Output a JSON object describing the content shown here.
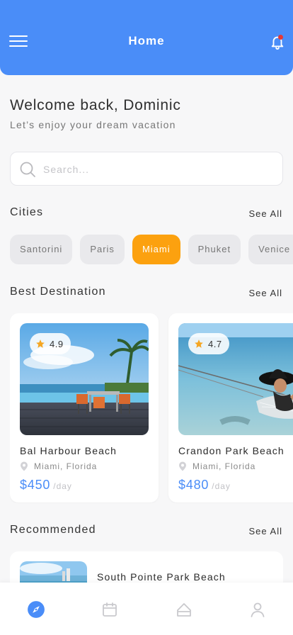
{
  "header": {
    "title": "Home",
    "menu_icon": "hamburger-menu-icon",
    "notification_icon": "bell-icon",
    "has_unread_notifications": true
  },
  "greeting": {
    "title": "Welcome back, Dominic",
    "subtitle": "Let’s enjoy your dream vacation"
  },
  "search": {
    "placeholder": "Search...",
    "value": ""
  },
  "cities": {
    "title": "Cities",
    "see_all": "See All",
    "items": [
      {
        "label": "Santorini",
        "active": false
      },
      {
        "label": "Paris",
        "active": false
      },
      {
        "label": "Miami",
        "active": true
      },
      {
        "label": "Phuket",
        "active": false
      },
      {
        "label": "Venice",
        "active": false
      }
    ]
  },
  "best_destination": {
    "title": "Best Destination",
    "see_all": "See All",
    "cards": [
      {
        "name": "Bal Harbour Beach",
        "rating": "4.9",
        "location": "Miami, Florida",
        "price": "$450",
        "per": "/day"
      },
      {
        "name": "Crandon Park Beach",
        "rating": "4.7",
        "location": "Miami, Florida",
        "price": "$480",
        "per": "/day"
      }
    ]
  },
  "recommended": {
    "title": "Recommended",
    "see_all": "See All",
    "items": [
      {
        "name": "South Pointe Park Beach"
      }
    ]
  },
  "bottom_nav": {
    "items": [
      {
        "icon": "compass-icon",
        "active": true
      },
      {
        "icon": "calendar-icon",
        "active": false
      },
      {
        "icon": "suitcase-icon",
        "active": false
      },
      {
        "icon": "profile-icon",
        "active": false
      }
    ]
  },
  "colors": {
    "primary": "#4a8df8",
    "accent": "#fca10f",
    "notification": "#e53935",
    "star": "#f5a623"
  }
}
